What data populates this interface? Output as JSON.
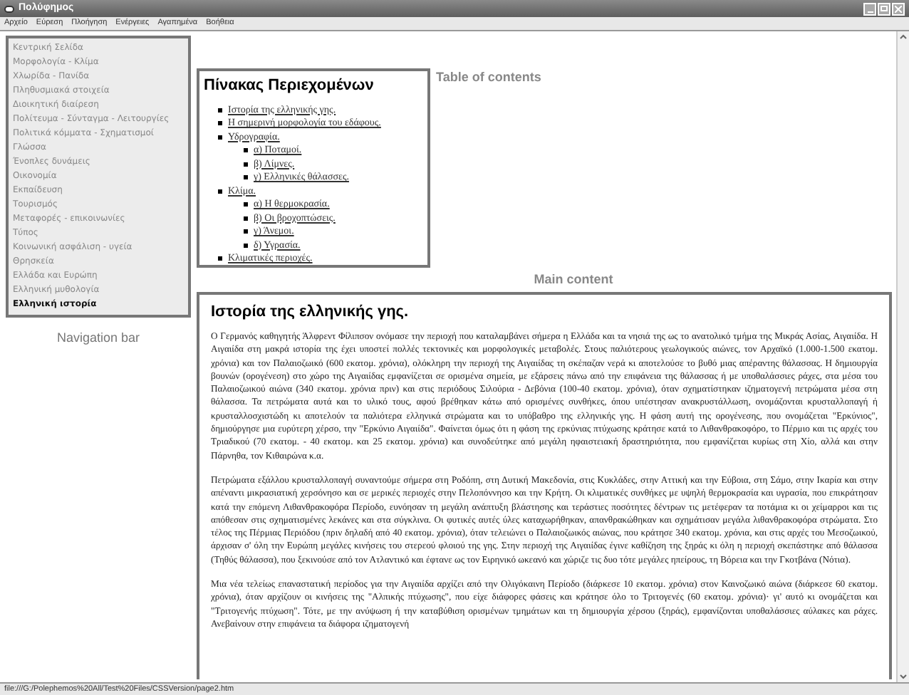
{
  "window": {
    "title": "Πολύφημος"
  },
  "menu": [
    "Αρχείο",
    "Εύρεση",
    "Πλοήγηση",
    "Ενέργειες",
    "Αγαπημένα",
    "Βοήθεια"
  ],
  "sidebar": {
    "label": "Navigation bar",
    "items": [
      {
        "label": "Κεντρική Σελίδα",
        "selected": false
      },
      {
        "label": "Μορφολογία - Κλίμα",
        "selected": false
      },
      {
        "label": "Χλωρίδα - Πανίδα",
        "selected": false
      },
      {
        "label": "Πληθυσμιακά στοιχεία",
        "selected": false
      },
      {
        "label": "Διοικητική διαίρεση",
        "selected": false
      },
      {
        "label": "Πολίτευμα - Σύνταγμα - Λειτουργίες",
        "selected": false
      },
      {
        "label": "Πολιτικά κόμματα - Σχηματισμοί",
        "selected": false
      },
      {
        "label": "Γλώσσα",
        "selected": false
      },
      {
        "label": "Ένοπλες δυνάμεις",
        "selected": false
      },
      {
        "label": "Οικονομία",
        "selected": false
      },
      {
        "label": "Εκπαίδευση",
        "selected": false
      },
      {
        "label": "Τουρισμός",
        "selected": false
      },
      {
        "label": "Μεταφορές - επικοινωνίες",
        "selected": false
      },
      {
        "label": "Τύπος",
        "selected": false
      },
      {
        "label": "Κοινωνική ασφάλιση - υγεία",
        "selected": false
      },
      {
        "label": "Θρησκεία",
        "selected": false
      },
      {
        "label": "Ελλάδα και Ευρώπη",
        "selected": false
      },
      {
        "label": "Ελληνική μυθολογία",
        "selected": false
      },
      {
        "label": "Ελληνική ιστορία",
        "selected": true
      }
    ]
  },
  "toc": {
    "label": "Table of contents",
    "title": "Πίνακας Περιεχομένων",
    "items": [
      {
        "label": "Ιστορία της ελληνικής γης."
      },
      {
        "label": "Η σημερινή μορφολογία του εδάφους."
      },
      {
        "label": "Υδρογραφία.",
        "children": [
          {
            "label": "α) Ποταμοί."
          },
          {
            "label": "β) Λίμνες."
          },
          {
            "label": "γ) Ελληνικές θάλασσες."
          }
        ]
      },
      {
        "label": "Κλίμα.",
        "children": [
          {
            "label": "α) Η θερμοκρασία."
          },
          {
            "label": "β) Οι βροχοπτώσεις."
          },
          {
            "label": "γ) Άνεμοι."
          },
          {
            "label": "δ) Υγρασία."
          }
        ]
      },
      {
        "label": "Κλιματικές περιοχές."
      }
    ]
  },
  "main": {
    "label": "Main content",
    "title": "Ιστορία της ελληνικής γης.",
    "paragraphs": [
      "Ο Γερμανός καθηγητής Άλφρεντ Φίλιπσον ονόμασε την περιοχή που καταλαμβάνει σήμερα η Ελλάδα και τα νησιά της ως το ανατολικό τμήμα της Μικράς Ασίας, Αιγαιίδα. Η Αιγαιίδα στη μακρά ιστορία της έχει υποστεί πολλές τεκτονικές και μορφολογικές μεταβολές. Στους παλιότερους γεωλογικούς αιώνες, τον Αρχαϊκό (1.000-1.500 εκατομ. χρόνια) και τον Παλαιοζωικό (600 εκατομ. χρόνια), ολόκληρη την περιοχή της Αιγαιίδας τη σκέπαζαν νερά κι αποτελούσε το βυθό μιας απέραντης θάλασσας. Η δημιουργία βουνών (ορογένεση) στο χώρο της Αιγαιίδας εμφανίζεται σε ορισμένα σημεία, με εξάρσεις πάνω από την επιφάνεια της θάλασσας ή με υποθαλάσσιες ράχες, στα μέσα του Παλαιοζωικού αιώνα (340 εκατομ. χρόνια πριν) και στις περιόδους Σιλούρια - Δεβόνια (100-40 εκατομ. χρόνια), όταν σχηματίστηκαν ιζηματογενή πετρώματα μέσα στη θάλασσα. Τα πετρώματα αυτά και το υλικό τους, αφού βρέθηκαν κάτω από ορισμένες συνθήκες, όπου υπέστησαν ανακρυστάλλωση, ονομάζονται κρυσταλλοπαγή ή κρυσταλλοσχιστώδη κι αποτελούν τα παλιότερα ελληνικά στρώματα και το υπόβαθρο της ελληνικής γης. Η φάση αυτή της ορογένεσης, που ονομάζεται \"Ερκύνιος\", δημιούργησε μια ευρύτερη χέρσο, την \"Ερκύνιο Αιγαιίδα\". Φαίνεται όμως ότι η φάση της ερκύνιας πτύχωσης κράτησε κατά το Λιθανθρακοφόρο, το Πέρμιο και τις αρχές του Τριαδικού (70 εκατομ. - 40 εκατομ. και 25 εκατομ. χρόνια) και συνοδεύτηκε από μεγάλη ηφαιστειακή δραστηριότητα, που εμφανίζεται κυρίως στη Χίο, αλλά και στην Πάρνηθα, τον Κιθαιρώνα κ.α.",
      "Πετρώματα εξάλλου κρυσταλλοπαγή συναντούμε σήμερα στη Ροδόπη, στη Δυτική Μακεδονία, στις Κυκλάδες, στην Αττική και την Εύβοια, στη Σάμο, στην Ικαρία και στην απέναντι μικρασιατική χερσόνησο και σε μερικές περιοχές στην Πελοπόννησο και την Κρήτη. Οι κλιματικές συνθήκες με υψηλή θερμοκρασία και υγρασία, που επικράτησαν κατά την επόμενη Λιθανθρακοφόρα Περίοδο, ευνόησαν τη μεγάλη ανάπτυξη βλάστησης και τεράστιες ποσότητες δέντρων τις μετέφεραν τα ποτάμια κι οι χείμαρροι και τις απόθεσαν στις σχηματισμένες λεκάνες και στα σύγκλινα. Οι φυτικές αυτές ύλες καταχωρήθηκαν, απανθρακώθηκαν και σχημάτισαν μεγάλα λιθανθρακοφόρα στρώματα. Στο τέλος της Πέρμιας Περιόδου (πριν δηλαδή από 40 εκατομ. χρόνια), όταν τελειώνει ο Παλαιοζωικός αιώνας, που κράτησε 340 εκατομ. χρόνια, και στις αρχές του Μεσοζωικού, άρχισαν σ' όλη την Ευρώπη μεγάλες κινήσεις του στερεού φλοιού της γης. Στην περιοχή της Αιγαιίδας έγινε καθίζηση της ξηράς κι όλη η περιοχή σκεπάστηκε από θάλασσα (Τηθύς θάλασσα), που ξεκινούσε από τον Ατλαντικό και έφτανε ως τον Ειρηνικό ωκεανό και χώριζε τις δυο τότε μεγάλες ηπείρους, τη Βόρεια και την Γκοτβάνα (Νότια).",
      "Μια νέα τελείως επαναστατική περίοδος για την Αιγαιίδα αρχίζει από την Ολιγόκαινη Περίοδο (διάρκεσε 10 εκατομ. χρόνια) στον Καινοζωικό αιώνα (διάρκεσε 60 εκατομ. χρόνια), όταν αρχίζουν οι κινήσεις της \"Αλπικής πτύχωσης\", που είχε διάφορες φάσεις και κράτησε όλο το Τριτογενές (60 εκατομ. χρόνια)· γι' αυτό κι ονομάζεται και \"Τριτογενής πτύχωση\". Τότε, με την ανύψωση ή την καταβύθιση ορισμένων τμημάτων και τη δημιουργία χέρσου (ξηράς), εμφανίζονται υποθαλάσσιες αύλακες και ράχες. Ανεβαίνουν στην επιφάνεια τα διάφορα ιζηματογενή"
    ]
  },
  "status_bar": "file:///G:/Polephemos%20All/Test%20Files/CSSVersion/page2.htm"
}
